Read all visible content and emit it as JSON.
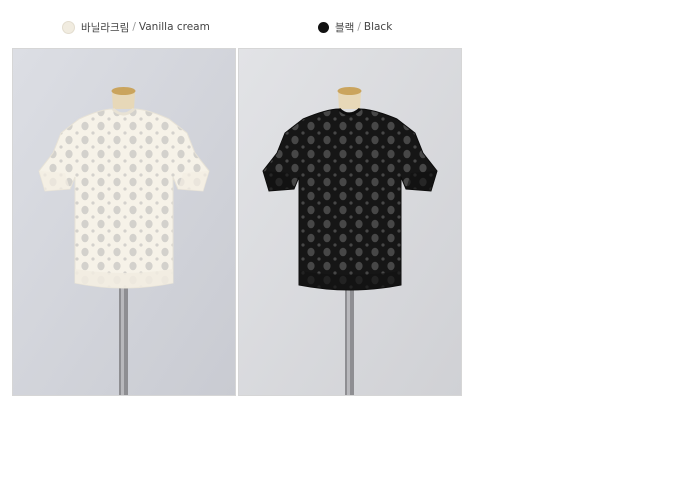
{
  "variants": [
    {
      "korean_name": "바닐라크림",
      "english_name": "Vanilla cream",
      "swatch_color": "#f1ece0",
      "garment_color": "#f6f2e8",
      "hole_color": "#d9d6d0"
    },
    {
      "korean_name": "블랙",
      "english_name": "Black",
      "swatch_color": "#111111",
      "garment_color": "#161616",
      "hole_color": "#4a4a4a"
    }
  ],
  "separator": "/"
}
